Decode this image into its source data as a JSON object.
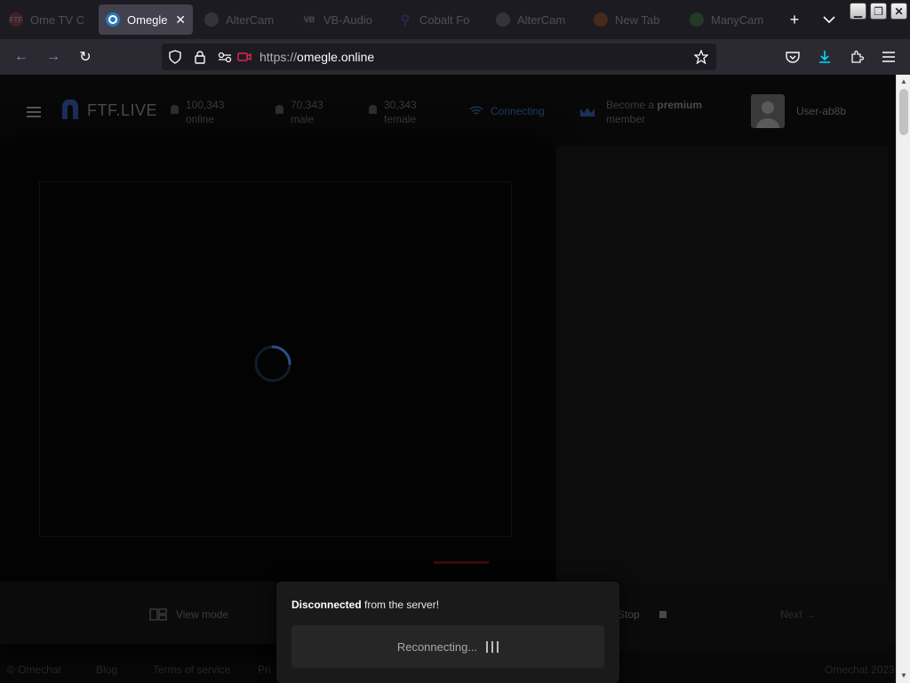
{
  "browser": {
    "tabs": [
      {
        "label": "Ome TV C",
        "favicon": "ftf-icon",
        "color": "#c0392b"
      },
      {
        "label": "Omegle",
        "favicon": "omegle-icon",
        "color": "#2a7ab5",
        "active": true
      },
      {
        "label": "AlterCam",
        "favicon": "altercam-icon",
        "color": "#8a8a8a"
      },
      {
        "label": "VB-Audio",
        "favicon": "vb-audio-icon",
        "color": "#222222"
      },
      {
        "label": "Cobalt Fo",
        "favicon": "search-icon",
        "color": "#4a5de0"
      },
      {
        "label": "AlterCam",
        "favicon": "altercam-icon",
        "color": "#8a8a8a"
      },
      {
        "label": "New Tab",
        "favicon": "firefox-icon",
        "color": "#e66000"
      },
      {
        "label": "ManyCam",
        "favicon": "manycam-icon",
        "color": "#3aaa35"
      }
    ],
    "url_scheme": "https://",
    "url_host": "omegle.online"
  },
  "site": {
    "brand": "FTF.LIVE",
    "stats": {
      "online": {
        "count": "100,343",
        "label": "online"
      },
      "male": {
        "count": "70,343",
        "label": "male"
      },
      "female": {
        "count": "30,343",
        "label": "female"
      }
    },
    "connection_status": "Connecting",
    "premium": {
      "prefix": "Become a",
      "highlight": "premium",
      "suffix": "member"
    },
    "username": "User-ab8b",
    "controls": {
      "view_mode": "View mode",
      "stop": "Stop",
      "next": "Next"
    },
    "footer": [
      "© Omechat",
      "Blog",
      "Terms of service",
      "Pri",
      "Omechat 2023"
    ]
  },
  "toast": {
    "bold": "Disconnected",
    "rest": "from the server!",
    "button": "Reconnecting..."
  }
}
